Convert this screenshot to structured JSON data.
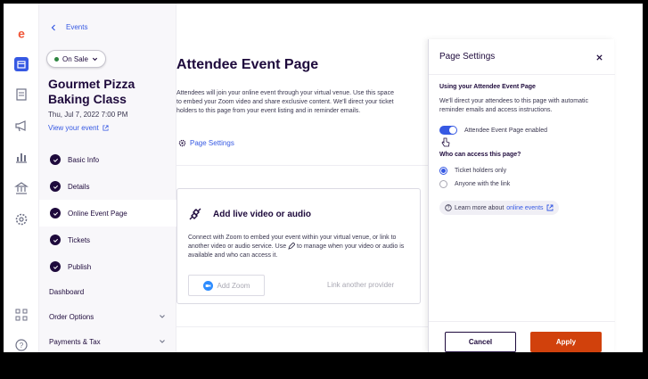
{
  "nav": {
    "back_label": "Events"
  },
  "event": {
    "status": "On Sale",
    "title": "Gourmet Pizza Baking Class",
    "date": "Thu, Jul 7, 2022 7:00 PM",
    "view_link": "View your event"
  },
  "steps": [
    {
      "label": "Basic Info"
    },
    {
      "label": "Details"
    },
    {
      "label": "Online Event Page"
    },
    {
      "label": "Tickets"
    },
    {
      "label": "Publish"
    }
  ],
  "menus": [
    {
      "label": "Dashboard"
    },
    {
      "label": "Order Options"
    },
    {
      "label": "Payments & Tax"
    }
  ],
  "main": {
    "title": "Attendee Event Page",
    "description": "Attendees will join your online event through your virtual venue. Use this space to embed your Zoom video and share exclusive content. We'll direct your ticket holders to this page from your event listing and in reminder emails.",
    "page_settings_link": "Page Settings",
    "card": {
      "title": "Add live video or audio",
      "text_before": "Connect with Zoom to embed your event within your virtual venue, or link to another video or audio service. Use",
      "text_after": "to manage when your video or audio is available and who can access it.",
      "add_zoom": "Add Zoom",
      "link_provider": "Link another provider"
    }
  },
  "panel": {
    "title": "Page Settings",
    "section_title": "Using your Attendee Event Page",
    "section_desc": "We'll direct your attendees to this page with automatic reminder emails and access instructions.",
    "toggle_label": "Attendee Event Page enabled",
    "toggle_on": true,
    "access_question": "Who can access this page?",
    "options": [
      {
        "label": "Ticket holders only",
        "selected": true
      },
      {
        "label": "Anyone with the link",
        "selected": false
      }
    ],
    "learn_prefix": "Learn more about",
    "learn_link": "online events",
    "cancel": "Cancel",
    "apply": "Apply"
  },
  "colors": {
    "brand": "#d1410c",
    "link": "#3659e3",
    "navy": "#1e0a3c",
    "zoom": "#2d8cff"
  }
}
